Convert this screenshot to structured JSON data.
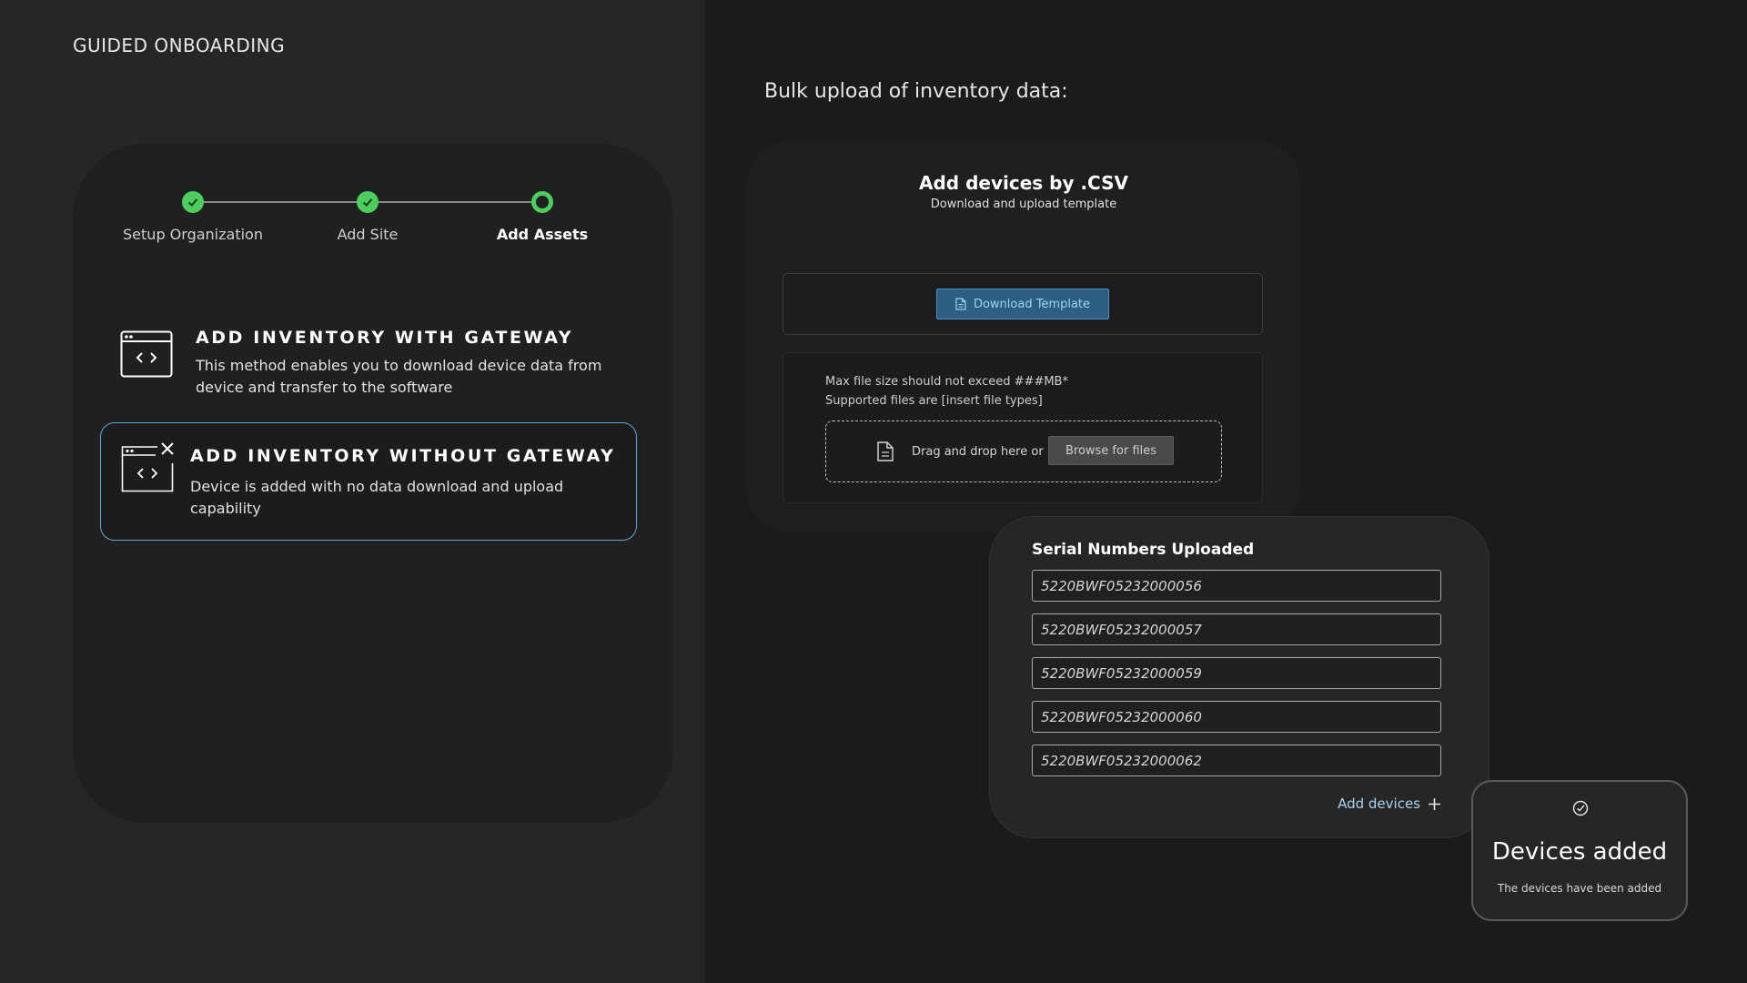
{
  "page_label": "GUIDED ONBOARDING",
  "stepper": {
    "steps": [
      {
        "label": "Setup Organization",
        "state": "complete"
      },
      {
        "label": "Add Site",
        "state": "complete"
      },
      {
        "label": "Add Assets",
        "state": "current"
      }
    ]
  },
  "options": [
    {
      "title": "ADD INVENTORY WITH GATEWAY",
      "description": "This method enables you to download device data from device and transfer to the software",
      "selected": false,
      "icon": "code-window-icon"
    },
    {
      "title": "ADD INVENTORY WITHOUT GATEWAY",
      "description": "Device is added with no data download and upload capability",
      "selected": true,
      "icon": "code-window-close-icon"
    }
  ],
  "bulk_upload": {
    "title": "Bulk upload of inventory data:",
    "heading": "Add devices by .CSV",
    "subheading": "Download and upload template",
    "download_label": "Download Template",
    "max_size_note": "Max file size should not exceed ###MB*",
    "file_types_note": "Supported files are [insert file types]",
    "drop_text": "Drag and drop here or",
    "browse_label": "Browse for files"
  },
  "serials": {
    "title": "Serial Numbers Uploaded",
    "items": [
      "5220BWF05232000056",
      "5220BWF05232000057",
      "5220BWF05232000059",
      "5220BWF05232000060",
      "5220BWF05232000062"
    ],
    "add_label": "Add devices"
  },
  "toast": {
    "title": "Devices added",
    "message": "The devices have been added"
  },
  "colors": {
    "step_complete": "#4ccd5e",
    "selected_border": "#5aa9d6",
    "download_button": "#2d5f84",
    "link": "#a9d3f0"
  }
}
